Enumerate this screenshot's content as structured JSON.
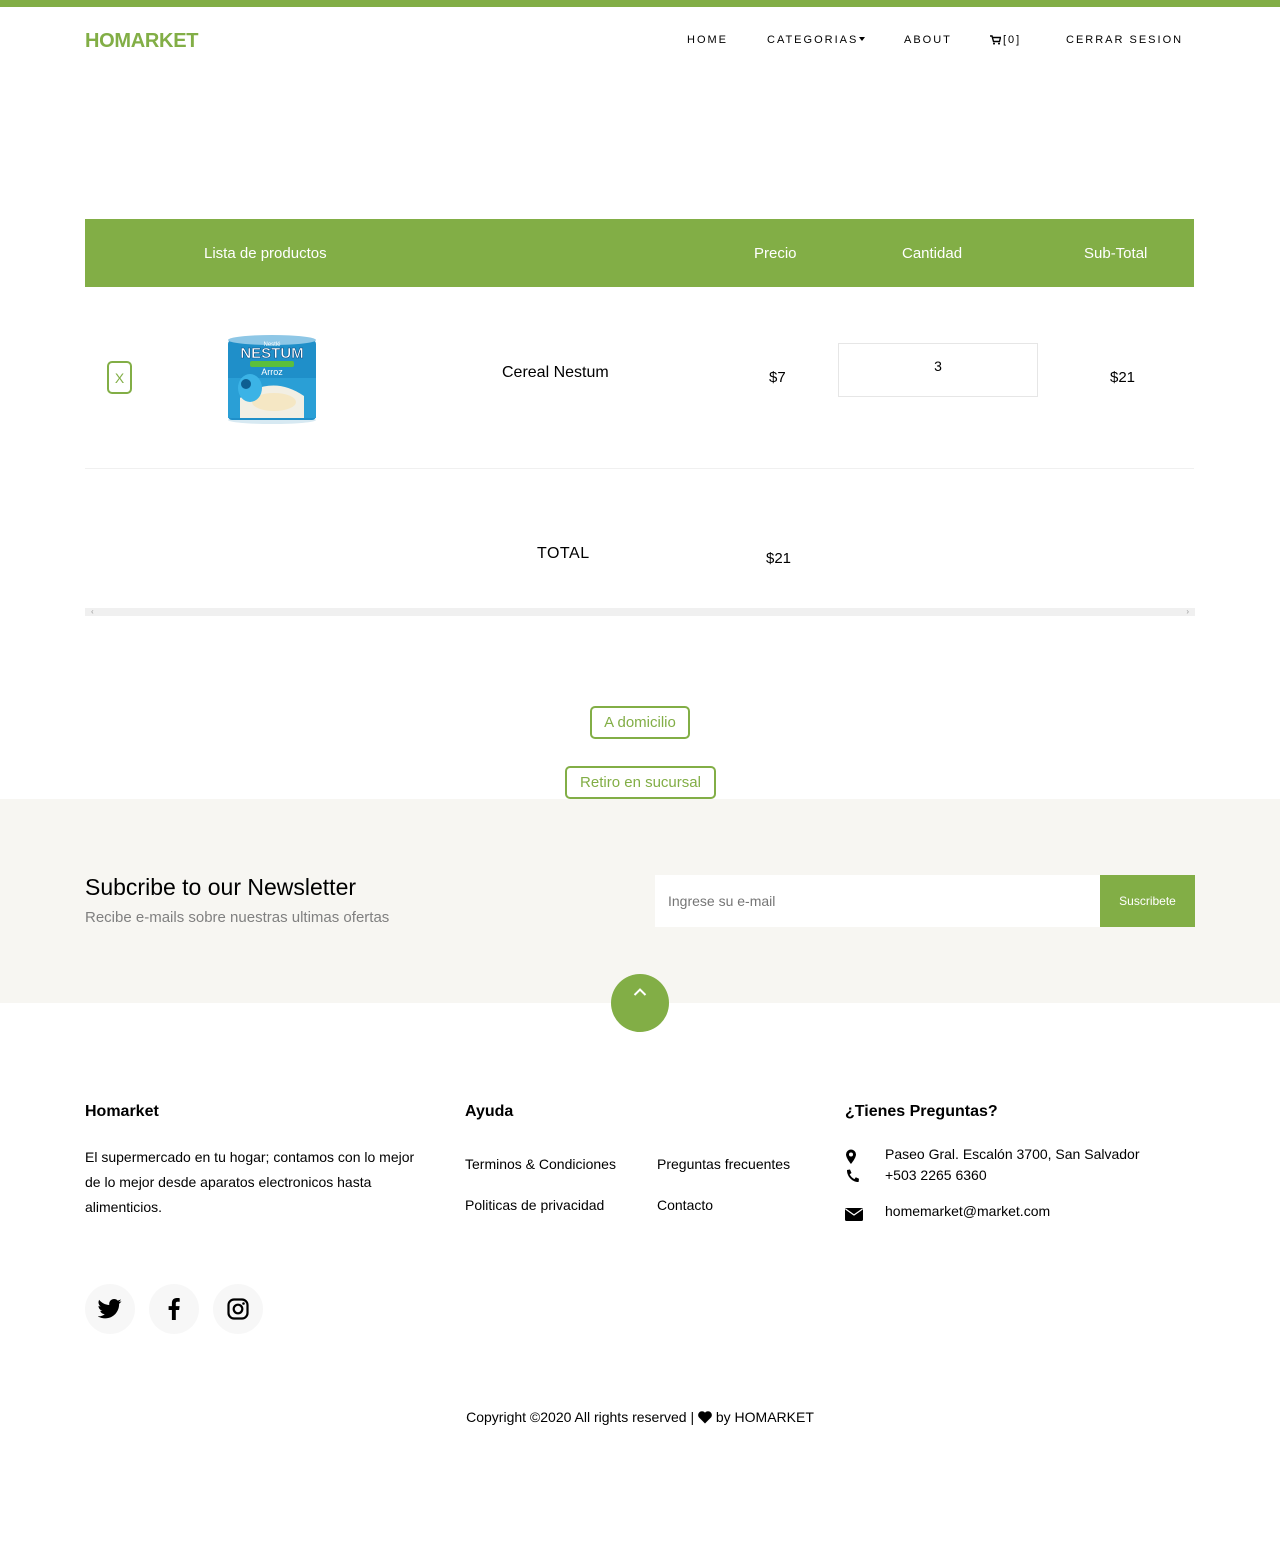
{
  "colors": {
    "accent": "#82ae46",
    "newsletter_bg": "#f7f6f2"
  },
  "navbar": {
    "brand": "HOMARKET",
    "items": [
      {
        "label": "HOME"
      },
      {
        "label": "CATEGORIAS"
      },
      {
        "label": "ABOUT"
      },
      {
        "label": "[0]"
      },
      {
        "label": "CERRAR SESION"
      }
    ]
  },
  "cart": {
    "headers": {
      "products": "Lista de productos",
      "price": "Precio",
      "quantity": "Cantidad",
      "subtotal": "Sub-Total"
    },
    "items": [
      {
        "remove": "X",
        "image_alt": "Nestum Arroz cereal can",
        "name": "Cereal Nestum",
        "price": "$7",
        "quantity": "3",
        "subtotal": "$21"
      }
    ],
    "total_label": "TOTAL",
    "total_value": "$21"
  },
  "delivery": {
    "home_label": "A domicilio",
    "branch_label": "Retiro en sucursal"
  },
  "newsletter": {
    "title": "Subcribe to our Newsletter",
    "subtitle": "Recibe e-mails sobre nuestras ultimas ofertas",
    "placeholder": "Ingrese su e-mail",
    "button": "Suscribete"
  },
  "footer": {
    "about": {
      "title": "Homarket",
      "text": "El supermercado en tu hogar; contamos con lo mejor de lo mejor desde aparatos electronicos hasta alimenticios."
    },
    "help": {
      "title": "Ayuda",
      "links": [
        "Terminos & Condiciones",
        "Preguntas frecuentes",
        "Politicas de privacidad",
        "Contacto"
      ]
    },
    "contact": {
      "title": "¿Tienes Preguntas?",
      "address": "Paseo Gral. Escalón 3700, San Salvador",
      "phone": "+503 2265 6360",
      "email": "homemarket@market.com"
    },
    "social": [
      "twitter-icon",
      "facebook-icon",
      "instagram-icon"
    ],
    "copyright_prefix": "Copyright ©2020 All rights reserved |",
    "copyright_suffix": "by HOMARKET"
  }
}
